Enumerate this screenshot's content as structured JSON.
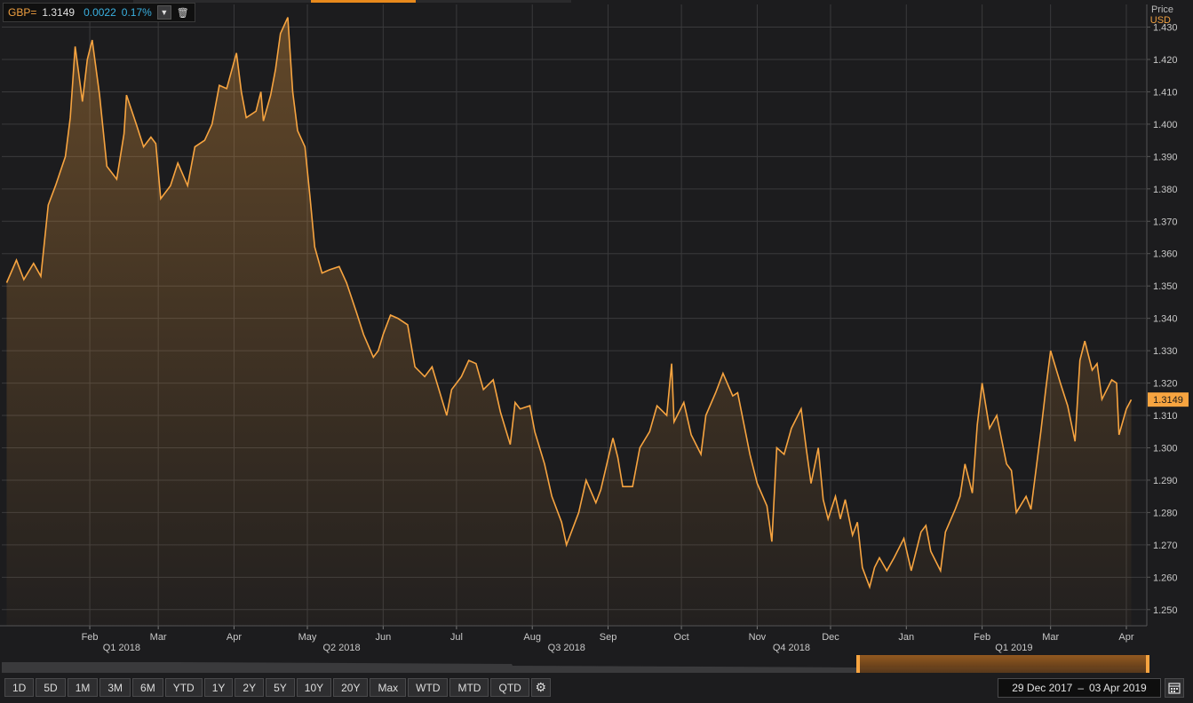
{
  "legend": {
    "ric": "GBP=",
    "price": "1.3149",
    "change": "0.0022",
    "change_pct": "0.17%"
  },
  "axis": {
    "price_title": "Price",
    "currency": "USD"
  },
  "last_price_tag": "1.3149",
  "toolbar": {
    "buttons": [
      "1D",
      "5D",
      "1M",
      "3M",
      "6M",
      "YTD",
      "1Y",
      "2Y",
      "5Y",
      "10Y",
      "20Y",
      "Max",
      "WTD",
      "MTD",
      "QTD"
    ]
  },
  "date_range": {
    "start": "29 Dec 2017",
    "separator": "–",
    "end": "03 Apr 2019"
  },
  "colors": {
    "line": "#f7a440",
    "background": "#1c1c1e",
    "grid": "#3a3a3c",
    "price_tag": "#f7a440"
  },
  "chart_data": {
    "type": "area",
    "title": "",
    "xlabel": "",
    "ylabel": "Price",
    "ylim": [
      1.245,
      1.437
    ],
    "y_ticks": [
      "1.250",
      "1.260",
      "1.270",
      "1.280",
      "1.290",
      "1.300",
      "1.310",
      "1.320",
      "1.330",
      "1.340",
      "1.350",
      "1.360",
      "1.370",
      "1.380",
      "1.390",
      "1.400",
      "1.410",
      "1.420",
      "1.430"
    ],
    "x_month_ticks": [
      {
        "label": "Feb",
        "date": "2018-02-01"
      },
      {
        "label": "Mar",
        "date": "2018-03-01"
      },
      {
        "label": "Apr",
        "date": "2018-04-01"
      },
      {
        "label": "May",
        "date": "2018-05-01"
      },
      {
        "label": "Jun",
        "date": "2018-06-01"
      },
      {
        "label": "Jul",
        "date": "2018-07-01"
      },
      {
        "label": "Aug",
        "date": "2018-08-01"
      },
      {
        "label": "Sep",
        "date": "2018-09-01"
      },
      {
        "label": "Oct",
        "date": "2018-10-01"
      },
      {
        "label": "Nov",
        "date": "2018-11-01"
      },
      {
        "label": "Dec",
        "date": "2018-12-01"
      },
      {
        "label": "Jan",
        "date": "2019-01-01"
      },
      {
        "label": "Feb",
        "date": "2019-02-01"
      },
      {
        "label": "Mar",
        "date": "2019-03-01"
      },
      {
        "label": "Apr",
        "date": "2019-04-01"
      }
    ],
    "x_quarter_ticks": [
      {
        "label": "Q1 2018",
        "date": "2018-02-14"
      },
      {
        "label": "Q2 2018",
        "date": "2018-05-15"
      },
      {
        "label": "Q3 2018",
        "date": "2018-08-15"
      },
      {
        "label": "Q4 2018",
        "date": "2018-11-15"
      },
      {
        "label": "Q1 2019",
        "date": "2019-02-14"
      }
    ],
    "series": [
      {
        "values": [
          [
            "2017-12-29",
            1.351
          ],
          [
            "2018-01-02",
            1.358
          ],
          [
            "2018-01-05",
            1.352
          ],
          [
            "2018-01-09",
            1.357
          ],
          [
            "2018-01-12",
            1.353
          ],
          [
            "2018-01-15",
            1.375
          ],
          [
            "2018-01-18",
            1.381
          ],
          [
            "2018-01-22",
            1.39
          ],
          [
            "2018-01-24",
            1.402
          ],
          [
            "2018-01-26",
            1.424
          ],
          [
            "2018-01-29",
            1.407
          ],
          [
            "2018-01-31",
            1.42
          ],
          [
            "2018-02-02",
            1.426
          ],
          [
            "2018-02-05",
            1.409
          ],
          [
            "2018-02-08",
            1.387
          ],
          [
            "2018-02-12",
            1.383
          ],
          [
            "2018-02-15",
            1.397
          ],
          [
            "2018-02-16",
            1.409
          ],
          [
            "2018-02-20",
            1.4
          ],
          [
            "2018-02-23",
            1.393
          ],
          [
            "2018-02-26",
            1.396
          ],
          [
            "2018-02-28",
            1.394
          ],
          [
            "2018-03-02",
            1.377
          ],
          [
            "2018-03-06",
            1.381
          ],
          [
            "2018-03-09",
            1.388
          ],
          [
            "2018-03-13",
            1.381
          ],
          [
            "2018-03-16",
            1.393
          ],
          [
            "2018-03-20",
            1.395
          ],
          [
            "2018-03-23",
            1.4
          ],
          [
            "2018-03-26",
            1.412
          ],
          [
            "2018-03-29",
            1.411
          ],
          [
            "2018-04-02",
            1.422
          ],
          [
            "2018-04-04",
            1.41
          ],
          [
            "2018-04-06",
            1.402
          ],
          [
            "2018-04-10",
            1.404
          ],
          [
            "2018-04-12",
            1.41
          ],
          [
            "2018-04-13",
            1.401
          ],
          [
            "2018-04-16",
            1.409
          ],
          [
            "2018-04-18",
            1.417
          ],
          [
            "2018-04-20",
            1.428
          ],
          [
            "2018-04-23",
            1.433
          ],
          [
            "2018-04-25",
            1.41
          ],
          [
            "2018-04-27",
            1.398
          ],
          [
            "2018-04-30",
            1.393
          ],
          [
            "2018-05-02",
            1.378
          ],
          [
            "2018-05-04",
            1.362
          ],
          [
            "2018-05-07",
            1.354
          ],
          [
            "2018-05-10",
            1.355
          ],
          [
            "2018-05-14",
            1.356
          ],
          [
            "2018-05-17",
            1.351
          ],
          [
            "2018-05-21",
            1.342
          ],
          [
            "2018-05-24",
            1.335
          ],
          [
            "2018-05-28",
            1.328
          ],
          [
            "2018-05-30",
            1.33
          ],
          [
            "2018-06-01",
            1.335
          ],
          [
            "2018-06-04",
            1.341
          ],
          [
            "2018-06-07",
            1.34
          ],
          [
            "2018-06-11",
            1.338
          ],
          [
            "2018-06-14",
            1.325
          ],
          [
            "2018-06-18",
            1.322
          ],
          [
            "2018-06-21",
            1.325
          ],
          [
            "2018-06-25",
            1.315
          ],
          [
            "2018-06-27",
            1.31
          ],
          [
            "2018-06-29",
            1.318
          ],
          [
            "2018-07-03",
            1.322
          ],
          [
            "2018-07-06",
            1.327
          ],
          [
            "2018-07-09",
            1.326
          ],
          [
            "2018-07-12",
            1.318
          ],
          [
            "2018-07-16",
            1.321
          ],
          [
            "2018-07-19",
            1.311
          ],
          [
            "2018-07-23",
            1.301
          ],
          [
            "2018-07-25",
            1.314
          ],
          [
            "2018-07-27",
            1.312
          ],
          [
            "2018-07-31",
            1.313
          ],
          [
            "2018-08-02",
            1.305
          ],
          [
            "2018-08-06",
            1.295
          ],
          [
            "2018-08-09",
            1.285
          ],
          [
            "2018-08-13",
            1.277
          ],
          [
            "2018-08-15",
            1.27
          ],
          [
            "2018-08-20",
            1.28
          ],
          [
            "2018-08-23",
            1.29
          ],
          [
            "2018-08-27",
            1.283
          ],
          [
            "2018-08-29",
            1.287
          ],
          [
            "2018-09-03",
            1.303
          ],
          [
            "2018-09-05",
            1.297
          ],
          [
            "2018-09-07",
            1.288
          ],
          [
            "2018-09-11",
            1.288
          ],
          [
            "2018-09-14",
            1.3
          ],
          [
            "2018-09-18",
            1.305
          ],
          [
            "2018-09-21",
            1.313
          ],
          [
            "2018-09-25",
            1.31
          ],
          [
            "2018-09-27",
            1.326
          ],
          [
            "2018-09-28",
            1.308
          ],
          [
            "2018-10-02",
            1.314
          ],
          [
            "2018-10-05",
            1.304
          ],
          [
            "2018-10-09",
            1.298
          ],
          [
            "2018-10-11",
            1.31
          ],
          [
            "2018-10-15",
            1.317
          ],
          [
            "2018-10-18",
            1.323
          ],
          [
            "2018-10-22",
            1.316
          ],
          [
            "2018-10-24",
            1.317
          ],
          [
            "2018-10-29",
            1.298
          ],
          [
            "2018-11-01",
            1.289
          ],
          [
            "2018-11-05",
            1.282
          ],
          [
            "2018-11-07",
            1.271
          ],
          [
            "2018-11-09",
            1.3
          ],
          [
            "2018-11-12",
            1.298
          ],
          [
            "2018-11-15",
            1.306
          ],
          [
            "2018-11-19",
            1.312
          ],
          [
            "2018-11-21",
            1.3
          ],
          [
            "2018-11-23",
            1.289
          ],
          [
            "2018-11-26",
            1.3
          ],
          [
            "2018-11-28",
            1.284
          ],
          [
            "2018-11-30",
            1.278
          ],
          [
            "2018-12-03",
            1.285
          ],
          [
            "2018-12-05",
            1.278
          ],
          [
            "2018-12-07",
            1.284
          ],
          [
            "2018-12-10",
            1.273
          ],
          [
            "2018-12-12",
            1.277
          ],
          [
            "2018-12-14",
            1.263
          ],
          [
            "2018-12-17",
            1.257
          ],
          [
            "2018-12-19",
            1.263
          ],
          [
            "2018-12-21",
            1.266
          ],
          [
            "2018-12-24",
            1.262
          ],
          [
            "2018-12-27",
            1.266
          ],
          [
            "2018-12-31",
            1.272
          ],
          [
            "2019-01-03",
            1.262
          ],
          [
            "2019-01-07",
            1.274
          ],
          [
            "2019-01-09",
            1.276
          ],
          [
            "2019-01-11",
            1.268
          ],
          [
            "2019-01-15",
            1.262
          ],
          [
            "2019-01-17",
            1.274
          ],
          [
            "2019-01-21",
            1.281
          ],
          [
            "2019-01-23",
            1.285
          ],
          [
            "2019-01-25",
            1.295
          ],
          [
            "2019-01-28",
            1.286
          ],
          [
            "2019-01-30",
            1.307
          ],
          [
            "2019-02-01",
            1.32
          ],
          [
            "2019-02-04",
            1.306
          ],
          [
            "2019-02-07",
            1.31
          ],
          [
            "2019-02-11",
            1.295
          ],
          [
            "2019-02-13",
            1.293
          ],
          [
            "2019-02-15",
            1.28
          ],
          [
            "2019-02-19",
            1.285
          ],
          [
            "2019-02-21",
            1.281
          ],
          [
            "2019-02-25",
            1.305
          ],
          [
            "2019-02-27",
            1.318
          ],
          [
            "2019-03-01",
            1.33
          ],
          [
            "2019-03-05",
            1.32
          ],
          [
            "2019-03-08",
            1.313
          ],
          [
            "2019-03-11",
            1.302
          ],
          [
            "2019-03-13",
            1.327
          ],
          [
            "2019-03-15",
            1.333
          ],
          [
            "2019-03-18",
            1.324
          ],
          [
            "2019-03-20",
            1.326
          ],
          [
            "2019-03-22",
            1.315
          ],
          [
            "2019-03-26",
            1.321
          ],
          [
            "2019-03-28",
            1.32
          ],
          [
            "2019-03-29",
            1.304
          ],
          [
            "2019-04-01",
            1.312
          ],
          [
            "2019-04-03",
            1.3149
          ]
        ]
      }
    ]
  }
}
